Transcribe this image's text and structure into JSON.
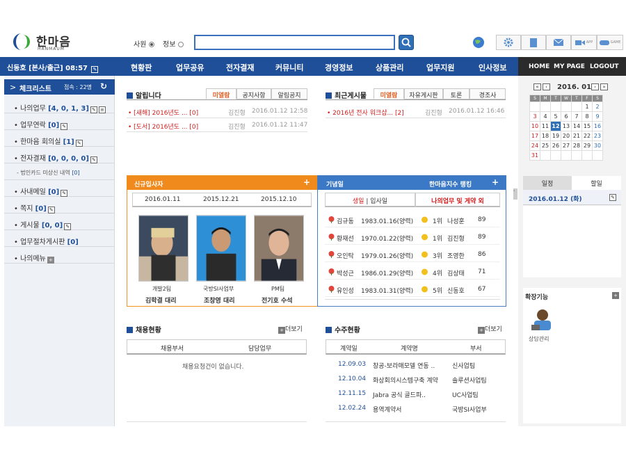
{
  "brand": {
    "name": "한마음",
    "sub": "HANMAUM"
  },
  "search": {
    "opt1": "사원",
    "opt2": "정보",
    "placeholder": ""
  },
  "toolbar": {
    "app": "APP",
    "game": "GAME"
  },
  "nav": {
    "user": "신동호 [본사/출근] 08:57",
    "menu": [
      "현황판",
      "업무공유",
      "전자결재",
      "커뮤니티",
      "경영정보",
      "상품관리",
      "업무지원",
      "인사정보"
    ],
    "right": [
      "HOME",
      "MY PAGE",
      "LOGOUT"
    ]
  },
  "sidebar": {
    "title": "체크리스트",
    "online": "접속 : 22명",
    "items": [
      {
        "label": "나의업무",
        "count": "[4, 0, 1, 3]"
      },
      {
        "label": "업무연락",
        "count": "[0]"
      },
      {
        "label": "한마음 회의실",
        "count": "[1]"
      },
      {
        "label": "전자결재",
        "count": "[0, 0, 0, 0]"
      },
      {
        "label": "- 법인카드 미상신 내역",
        "count": "[0]"
      },
      {
        "label": "사내메일",
        "count": "[0]"
      },
      {
        "label": "쪽지",
        "count": "[0]"
      },
      {
        "label": "게시물",
        "count": "[0, 0]"
      },
      {
        "label": "업무절차게시판",
        "count": "[0]"
      },
      {
        "label": "나의메뉴",
        "count": ""
      }
    ]
  },
  "notice": {
    "title": "알립니다",
    "tabs": [
      "미열람",
      "공지사항",
      "알림공지"
    ],
    "rows": [
      {
        "title": "[새해] 2016년도 ...",
        "count": "[0]",
        "author": "김진형",
        "date": "2016.01.12 12:58"
      },
      {
        "title": "[도서] 2016년도 ...",
        "count": "[0]",
        "author": "김진형",
        "date": "2016.01.12 11:47"
      }
    ]
  },
  "board": {
    "title": "최근게시물",
    "tabs": [
      "미열람",
      "자유게시판",
      "토론",
      "경조사"
    ],
    "rows": [
      {
        "title": "2016년 전사 워크샵...",
        "count": "[2]",
        "author": "김진형",
        "date": "2016.01.12 16:46"
      }
    ]
  },
  "newhire": {
    "title": "신규입사자",
    "plus": "+",
    "dates": [
      "2016.01.11",
      "2015.12.21",
      "2015.12.10"
    ],
    "people": [
      {
        "dept": "개발2팀",
        "name": "김학결 대리"
      },
      {
        "dept": "국방SI사업부",
        "name": "조창영 대리"
      },
      {
        "dept": "PM팀",
        "name": "전기호 수석"
      }
    ]
  },
  "anniv": {
    "title": "기념일",
    "rank_title": "한마음지수 랭킹",
    "plus": "+",
    "tab1": "생일",
    "sep": "|",
    "tab2": "입사일",
    "tab3": "나의업무 및 게약 외",
    "rows": [
      {
        "name": "김규동",
        "date": "1983.01.16(양력)",
        "rank": "1위",
        "rname": "나성훈",
        "score": "89"
      },
      {
        "name": "황재선",
        "date": "1970.01.22(양력)",
        "rank": "1위",
        "rname": "김진형",
        "score": "89"
      },
      {
        "name": "오인탁",
        "date": "1979.01.26(양력)",
        "rank": "3위",
        "rname": "조영한",
        "score": "86"
      },
      {
        "name": "박성근",
        "date": "1986.01.29(양력)",
        "rank": "4위",
        "rname": "김상태",
        "score": "71"
      },
      {
        "name": "유인성",
        "date": "1983.01.31(양력)",
        "rank": "5위",
        "rname": "신동호",
        "score": "67"
      }
    ]
  },
  "recruit": {
    "title": "채용현황",
    "more": "더보기",
    "cols": [
      "채용부서",
      "담당업무"
    ],
    "empty": "채용요청건이 없습니다."
  },
  "orders": {
    "title": "수주현황",
    "more": "더보기",
    "cols": [
      "계약일",
      "계약명",
      "부서"
    ],
    "rows": [
      {
        "date": "12.09.03",
        "name": "창공-보라매모델 연동 ..",
        "dept": "신사업팀"
      },
      {
        "date": "12.10.04",
        "name": "화상회의시스템구축 계약",
        "dept": "솔루션사업팀"
      },
      {
        "date": "12.11.15",
        "name": "Jabra 공식 골드파..",
        "dept": "UC사업팀"
      },
      {
        "date": "12.02.24",
        "name": "용역계약서",
        "dept": "국방SI사업부"
      }
    ]
  },
  "calendar": {
    "title": "2016. 01",
    "days": [
      "S",
      "M",
      "T",
      "W",
      "T",
      "F",
      "S"
    ],
    "weeks": [
      [
        "",
        "",
        "",
        "",
        "",
        "1",
        "2"
      ],
      [
        "3",
        "4",
        "5",
        "6",
        "7",
        "8",
        "9"
      ],
      [
        "10",
        "11",
        "12",
        "13",
        "14",
        "15",
        "16"
      ],
      [
        "17",
        "18",
        "19",
        "20",
        "21",
        "22",
        "23"
      ],
      [
        "24",
        "25",
        "26",
        "27",
        "28",
        "29",
        "30"
      ],
      [
        "31",
        "",
        "",
        "",
        "",
        "",
        ""
      ]
    ],
    "today": "12"
  },
  "schedule": {
    "tab1": "일정",
    "tab2": "할일",
    "date": "2016.01.12 (화)"
  },
  "ext": {
    "title": "확장기능",
    "item": "상담관리"
  }
}
